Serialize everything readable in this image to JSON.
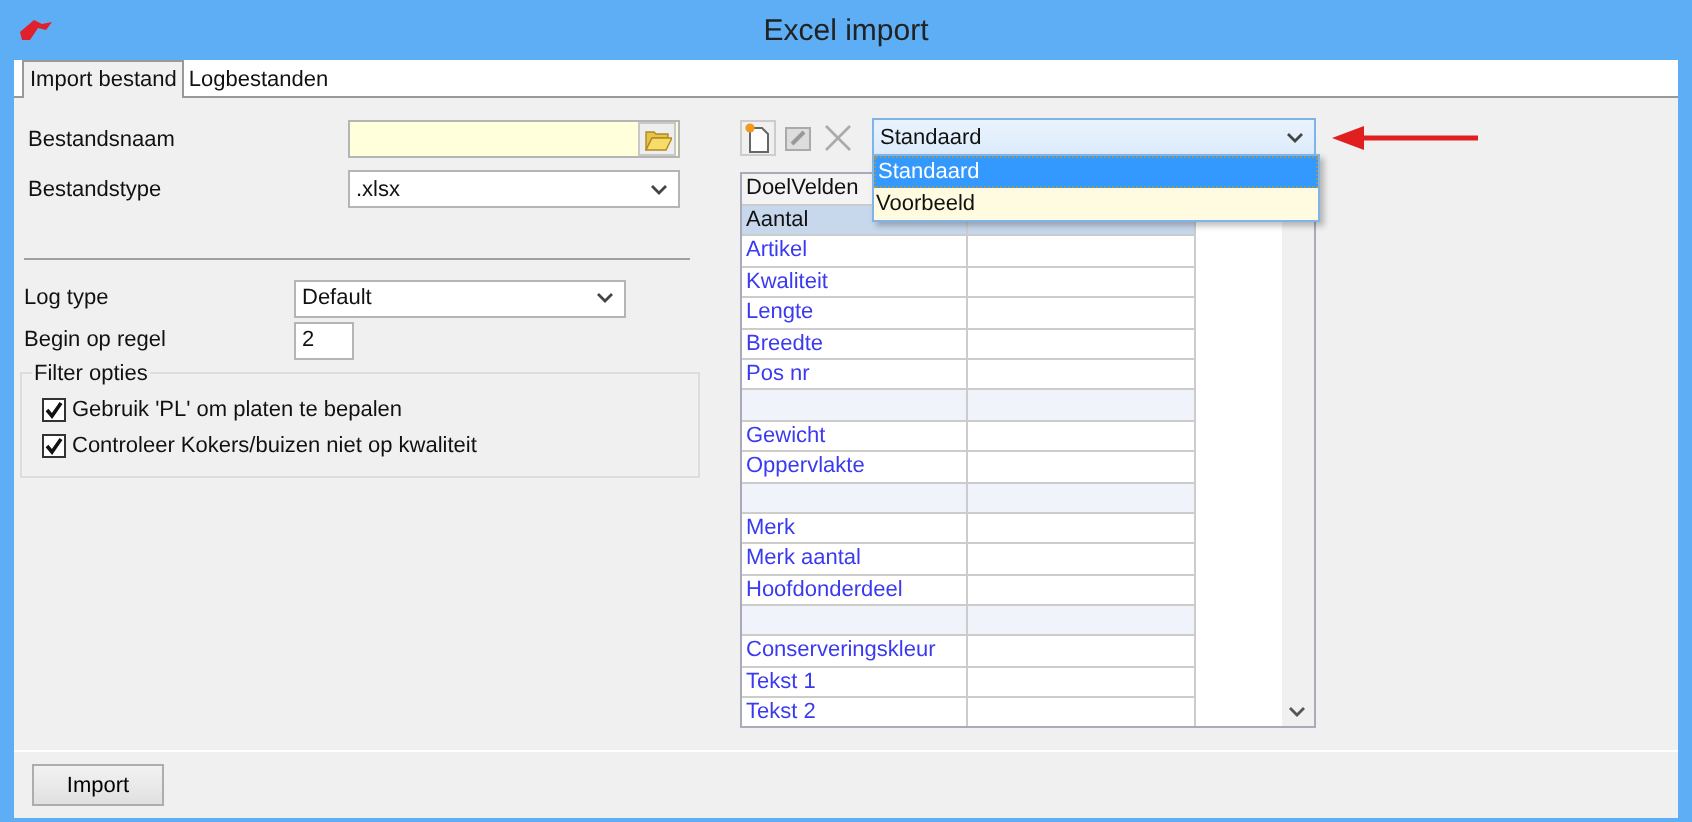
{
  "window": {
    "title": "Excel import"
  },
  "tabs": [
    {
      "label": "Import bestand",
      "selected": true
    },
    {
      "label": "Logbestanden",
      "selected": false
    }
  ],
  "file": {
    "name_label": "Bestandsnaam",
    "type_label": "Bestandstype",
    "type_value": ".xlsx"
  },
  "log": {
    "type_label": "Log type",
    "type_value": "Default",
    "start_label": "Begin op regel",
    "start_value": "2"
  },
  "filter": {
    "title": "Filter opties",
    "options": [
      {
        "label": "Gebruik 'PL' om platen te bepalen",
        "checked": true
      },
      {
        "label": "Controleer Kokers/buizen niet op kwaliteit",
        "checked": true
      }
    ]
  },
  "mapping": {
    "preset": "Standaard",
    "dropdown_open": true,
    "preset_options": [
      {
        "label": "Standaard",
        "selected": true
      },
      {
        "label": "Voorbeeld",
        "selected": false
      }
    ],
    "column_1": "DoelVelden",
    "rows": [
      {
        "kind": "field",
        "label": "Aantal",
        "selected": true
      },
      {
        "kind": "field",
        "label": "Artikel",
        "selected": false
      },
      {
        "kind": "field",
        "label": "Kwaliteit",
        "selected": false
      },
      {
        "kind": "field",
        "label": "Lengte",
        "selected": false
      },
      {
        "kind": "field",
        "label": "Breedte",
        "selected": false
      },
      {
        "kind": "field",
        "label": "Pos nr",
        "selected": false
      },
      {
        "kind": "separator"
      },
      {
        "kind": "field",
        "label": "Gewicht",
        "selected": false
      },
      {
        "kind": "field",
        "label": "Oppervlakte",
        "selected": false
      },
      {
        "kind": "separator"
      },
      {
        "kind": "field",
        "label": "Merk",
        "selected": false
      },
      {
        "kind": "field",
        "label": "Merk aantal",
        "selected": false
      },
      {
        "kind": "field",
        "label": "Hoofdonderdeel",
        "selected": false
      },
      {
        "kind": "separator"
      },
      {
        "kind": "field",
        "label": "Conserveringskleur",
        "selected": false
      },
      {
        "kind": "field",
        "label": "Tekst 1",
        "selected": false
      },
      {
        "kind": "field",
        "label": "Tekst 2",
        "selected": false
      }
    ]
  },
  "buttons": [
    "Import"
  ]
}
